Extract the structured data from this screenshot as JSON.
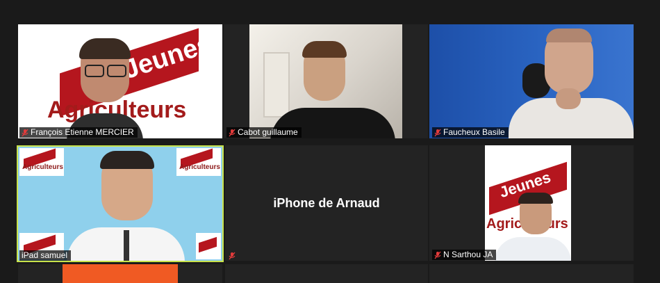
{
  "participants": [
    {
      "name": "François Etienne MERCIER",
      "muted": true
    },
    {
      "name": "Cabot guillaume",
      "muted": true
    },
    {
      "name": "Faucheux Basile",
      "muted": true
    },
    {
      "name": "iPad samuel",
      "muted": false,
      "active_speaker": true
    },
    {
      "name": "iPhone de Arnaud",
      "muted": true,
      "video_off": true
    },
    {
      "name": "N Sarthou JA",
      "muted": true
    }
  ],
  "logo": {
    "top": "Jeunes",
    "bottom": "Agriculteurs"
  },
  "colors": {
    "active_border": "#c8e24a",
    "brand_red": "#b5161e",
    "share_bar": "#f05a23"
  }
}
